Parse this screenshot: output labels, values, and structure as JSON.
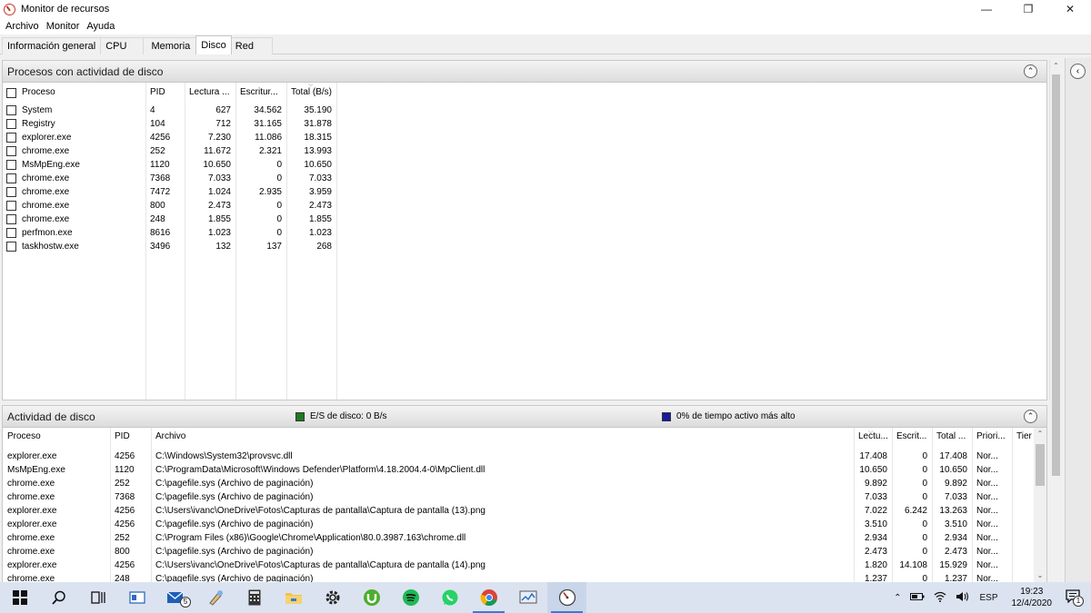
{
  "window": {
    "title": "Monitor de recursos"
  },
  "menu": [
    "Archivo",
    "Monitor",
    "Ayuda"
  ],
  "tabs": [
    "Información general",
    "CPU",
    "Memoria",
    "Disco",
    "Red"
  ],
  "active_tab": "Disco",
  "processes_panel": {
    "title": "Procesos con actividad de disco",
    "columns": [
      "Proceso",
      "PID",
      "Lectura ...",
      "Escritur...",
      "Total (B/s)"
    ],
    "rows": [
      [
        "System",
        "4",
        "627",
        "34.562",
        "35.190"
      ],
      [
        "Registry",
        "104",
        "712",
        "31.165",
        "31.878"
      ],
      [
        "explorer.exe",
        "4256",
        "7.230",
        "11.086",
        "18.315"
      ],
      [
        "chrome.exe",
        "252",
        "11.672",
        "2.321",
        "13.993"
      ],
      [
        "MsMpEng.exe",
        "1120",
        "10.650",
        "0",
        "10.650"
      ],
      [
        "chrome.exe",
        "7368",
        "7.033",
        "0",
        "7.033"
      ],
      [
        "chrome.exe",
        "7472",
        "1.024",
        "2.935",
        "3.959"
      ],
      [
        "chrome.exe",
        "800",
        "2.473",
        "0",
        "2.473"
      ],
      [
        "chrome.exe",
        "248",
        "1.855",
        "0",
        "1.855"
      ],
      [
        "perfmon.exe",
        "8616",
        "1.023",
        "0",
        "1.023"
      ],
      [
        "taskhostw.exe",
        "3496",
        "132",
        "137",
        "268"
      ]
    ]
  },
  "activity_panel": {
    "title": "Actividad de disco",
    "io_label": "E/S de disco: 0 B/s",
    "active_time_label": "0% de tiempo activo más alto",
    "io_color": "#1f7a1f",
    "active_color": "#1a1aa0",
    "columns": [
      "Proceso",
      "PID",
      "Archivo",
      "Lectu...",
      "Escrit...",
      "Total ...",
      "Priori...",
      "Tier"
    ],
    "rows": [
      [
        "explorer.exe",
        "4256",
        "C:\\Windows\\System32\\provsvc.dll",
        "17.408",
        "0",
        "17.408",
        "Nor..."
      ],
      [
        "MsMpEng.exe",
        "1120",
        "C:\\ProgramData\\Microsoft\\Windows Defender\\Platform\\4.18.2004.4-0\\MpClient.dll",
        "10.650",
        "0",
        "10.650",
        "Nor..."
      ],
      [
        "chrome.exe",
        "252",
        "C:\\pagefile.sys (Archivo de paginación)",
        "9.892",
        "0",
        "9.892",
        "Nor..."
      ],
      [
        "chrome.exe",
        "7368",
        "C:\\pagefile.sys (Archivo de paginación)",
        "7.033",
        "0",
        "7.033",
        "Nor..."
      ],
      [
        "explorer.exe",
        "4256",
        "C:\\Users\\ivanc\\OneDrive\\Fotos\\Capturas de pantalla\\Captura de pantalla (13).png",
        "7.022",
        "6.242",
        "13.263",
        "Nor..."
      ],
      [
        "explorer.exe",
        "4256",
        "C:\\pagefile.sys (Archivo de paginación)",
        "3.510",
        "0",
        "3.510",
        "Nor..."
      ],
      [
        "chrome.exe",
        "252",
        "C:\\Program Files (x86)\\Google\\Chrome\\Application\\80.0.3987.163\\chrome.dll",
        "2.934",
        "0",
        "2.934",
        "Nor..."
      ],
      [
        "chrome.exe",
        "800",
        "C:\\pagefile.sys (Archivo de paginación)",
        "2.473",
        "0",
        "2.473",
        "Nor..."
      ],
      [
        "explorer.exe",
        "4256",
        "C:\\Users\\ivanc\\OneDrive\\Fotos\\Capturas de pantalla\\Captura de pantalla (14).png",
        "1.820",
        "14.108",
        "15.929",
        "Nor..."
      ],
      [
        "chrome.exe",
        "248",
        "C:\\pagefile.sys (Archivo de paginación)",
        "1.237",
        "0",
        "1.237",
        "Nor..."
      ]
    ]
  },
  "taskbar": {
    "mail_badge": "5",
    "lang": "ESP",
    "time": "19:23",
    "date": "12/4/2020",
    "notif_count": "1"
  }
}
